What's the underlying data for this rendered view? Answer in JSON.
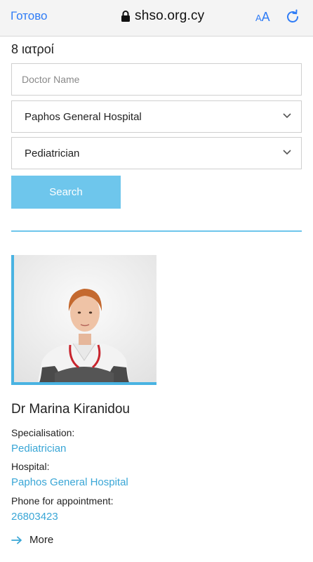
{
  "browser": {
    "done_label": "Готово",
    "url": "shso.org.cy",
    "text_size_small": "A",
    "text_size_big": "A",
    "accent_color": "#2f7cf6"
  },
  "results": {
    "count_label": "8 ιατροί"
  },
  "filters": {
    "doctor_name_placeholder": "Doctor Name",
    "doctor_name_value": "",
    "hospital_selected": "Paphos General Hospital",
    "specialty_selected": "Pediatrician",
    "search_label": "Search",
    "accent_color": "#6ec6ec"
  },
  "doctor": {
    "name": "Dr Marina Kiranidou",
    "specialisation_label": "Specialisation:",
    "specialisation_value": "Pediatrician",
    "hospital_label": "Hospital:",
    "hospital_value": "Paphos General Hospital",
    "phone_label": "Phone for appointment:",
    "phone_value": "26803423",
    "more_label": "More",
    "link_color": "#39a6d6"
  },
  "icons": {
    "lock": "lock-icon",
    "reload": "reload-icon",
    "chevron": "chevron-down-icon",
    "arrow": "arrow-right-icon"
  }
}
